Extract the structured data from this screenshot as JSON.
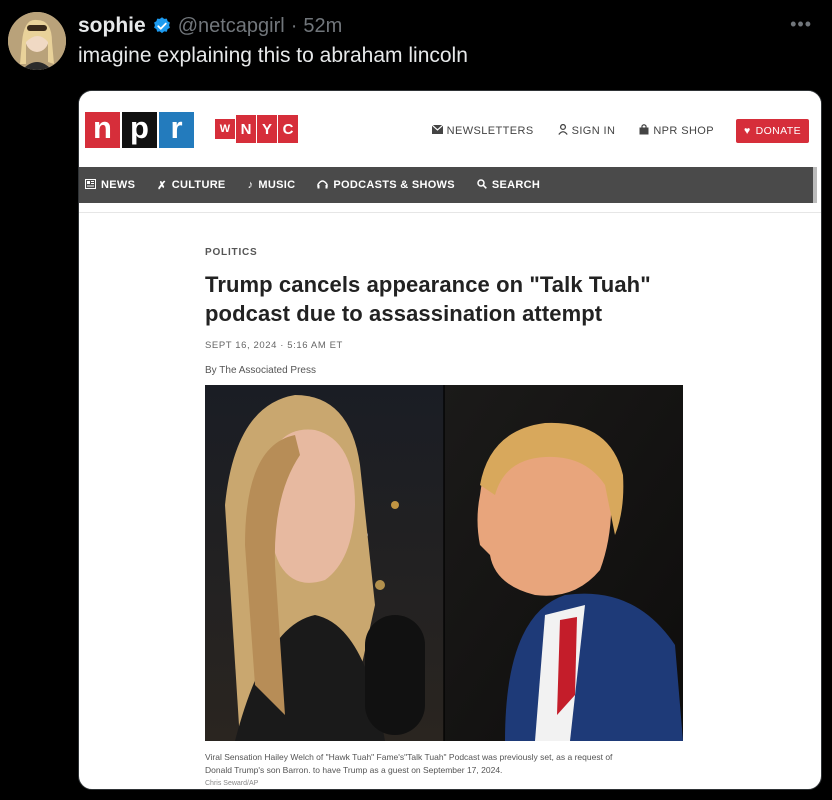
{
  "tweet": {
    "display_name": "sophie",
    "handle": "@netcapgirl",
    "separator": "·",
    "time": "52m",
    "text": "imagine explaining this to abraham lincoln",
    "more_icon": "more-icon",
    "verified_icon": "verified-badge-icon"
  },
  "site": {
    "npr_letters": [
      "n",
      "p",
      "r"
    ],
    "npr_colors": [
      "#d62e3a",
      "#111111",
      "#237bbd"
    ],
    "wnyc_letters": [
      "W",
      "N",
      "Y",
      "C"
    ],
    "top_links": [
      {
        "label": "NEWSLETTERS",
        "icon": "mail-icon"
      },
      {
        "label": "SIGN IN",
        "icon": "user-icon"
      },
      {
        "label": "NPR SHOP",
        "icon": "bag-icon"
      }
    ],
    "donate_label": "DONATE",
    "nav": [
      {
        "label": "NEWS",
        "icon": "newspaper-icon"
      },
      {
        "label": "CULTURE",
        "icon": "dancer-icon"
      },
      {
        "label": "MUSIC",
        "icon": "music-note-icon"
      },
      {
        "label": "PODCASTS & SHOWS",
        "icon": "headphones-icon"
      },
      {
        "label": "SEARCH",
        "icon": "search-icon"
      }
    ]
  },
  "article": {
    "kicker": "POLITICS",
    "headline_line1": "Trump cancels appearance on \"Talk Tuah\"",
    "headline_line2": "podcast due to assassination attempt",
    "dateline": "SEPT 16, 2024 · 5:16 AM ET",
    "byline": "By The Associated Press",
    "caption_line1": "Viral Sensation Hailey Welch of \"Hawk Tuah\" Fame's\"Talk Tuah\" Podcast was previously set, as a request of",
    "caption_line2": "Donald Trump's son Barron. to have Trump as a guest on September 17, 2024.",
    "credit": "Chris Seward/AP"
  },
  "colors": {
    "background": "#000000",
    "text": "#e7e9ea",
    "muted": "#71767b",
    "verified": "#1d9bf0",
    "npr_red": "#d62e3a",
    "nav_bg": "#4a4a4a"
  }
}
